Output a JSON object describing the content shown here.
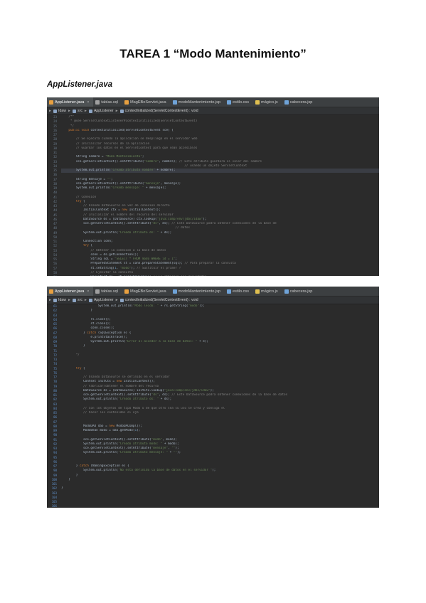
{
  "document": {
    "title": "TAREA 1 “Modo Mantenimiento”",
    "subtitle": "AppListener.java"
  },
  "shot1": {
    "tabs": [
      {
        "label": "AppListener.java",
        "active": true,
        "color": "#e8a040"
      },
      {
        "label": "tablas.sql",
        "active": false,
        "color": "#a0a0a0"
      },
      {
        "label": "MagEBoServlet.java",
        "active": false,
        "color": "#e8a040"
      },
      {
        "label": "modoMantenimiento.jsp",
        "active": false,
        "color": "#6fa3d8"
      },
      {
        "label": "estilo.css",
        "active": false,
        "color": "#6fa3d8"
      },
      {
        "label": "mágico.js",
        "active": false,
        "color": "#e0c050"
      },
      {
        "label": "cabecera.jsp",
        "active": false,
        "color": "#6fa3d8"
      }
    ],
    "crumbs": [
      "Idaw",
      "src",
      "AppListener",
      "contextInitialized(ServletContextEvent) : void"
    ],
    "line_numbers": [
      "23",
      "24",
      "25",
      "26",
      "27",
      "28",
      "29",
      "30",
      "31",
      "32",
      "33",
      "34",
      "35",
      "36",
      "37",
      "38",
      "39",
      "40",
      "41",
      "42",
      "43",
      "44",
      "45",
      "46",
      "47",
      "48",
      "49",
      "50",
      "51",
      "52",
      "53",
      "54",
      "55",
      "56",
      "57",
      "58",
      "59",
      "60",
      "61"
    ],
    "lines": [
      "    /**",
      "     * @see ServletContextListener#contextInitialized(ServletContextEvent)",
      "     */",
      "    public void contextInitialized(ServletContextEvent sce) {",
      "",
      "        // Se ejecuta cuando la aplicacion se despliega en el servidor web",
      "        // Inicializar recursos de la aplicacion",
      "        // Guardar los datos en el ServletContext para que sean accesibles",
      "",
      "        String nombre = \"Modo Mantenimiento\";",
      "        sce.getServletContext().setAttribute(\"nombre\", nombre); // Este atributo guardara el valor del nombre",
      "                                                                   // usando un objeto ServletContext",
      "        System.out.println(\"Creado atributo nombre\" + nombre);",
      "",
      "        String mensaje = \"\";",
      "        sce.getServletContext().setAttribute(\"mensaje\", mensaje);",
      "        System.out.println(\"Creado mensaje: \" + mensaje);",
      "",
      "        // Conexion",
      "        try {",
      "            // Usando DataSource en vez de conexion directa",
      "            InitialContext ctx = new InitialContext();",
      "            // Inicializar el nombre del recurso del servidor",
      "            DataSource ds = (DataSource) ctx.lookup(\"java:comp/env/jdbc/idaw\");",
      "            sce.getServletContext().setAttribute(\"ds\", ds); // Este DataSource podra obtener conexiones de la base de",
      "                                                              // datos",
      "            System.out.println(\"Creado atributo ds: \" + ds);",
      "",
      "            Connection conn;",
      "            try {",
      "                // Obtener la conexion a la base de datos",
      "                conn = ds.getConnection();",
      "                String sql = \"SELECT * FROM modo WHERE id = 1\";",
      "                PreparedStatement st = conn.prepareStatement(sql); // Para preparar la consulta",
      "                st.setString(1, \"modo\"); // Sustituir el primer ?",
      "                // Ejecutar la consulta",
      "                ResultSet rs = st.executeQuery(); // Se obtienen los resultados",
      "                while (rs.next()) {",
      "                    modo = rs.getString(\"modo\");"
    ],
    "highlight_index": 12
  },
  "shot2": {
    "tabs": [
      {
        "label": "AppListener.java",
        "active": true,
        "color": "#e8a040"
      },
      {
        "label": "tablas.sql",
        "active": false,
        "color": "#a0a0a0"
      },
      {
        "label": "MagEBoServlet.java",
        "active": false,
        "color": "#e8a040"
      },
      {
        "label": "modoMantenimiento.jsp",
        "active": false,
        "color": "#6fa3d8"
      },
      {
        "label": "estilo.css",
        "active": false,
        "color": "#6fa3d8"
      },
      {
        "label": "mágico.js",
        "active": false,
        "color": "#e0c050"
      },
      {
        "label": "cabecera.jsp",
        "active": false,
        "color": "#6fa3d8"
      }
    ],
    "crumbs": [
      "Idaw",
      "src",
      "AppListener",
      "contextInitialized(ServletContextEvent) : void"
    ],
    "line_numbers": [
      "61",
      "62",
      "63",
      "64",
      "65",
      "66",
      "67",
      "68",
      "69",
      "70",
      "71",
      "72",
      "73",
      "74",
      "75",
      "76",
      "77",
      "78",
      "79",
      "80",
      "81",
      "82",
      "83",
      "84",
      "85",
      "86",
      "87",
      "88",
      "89",
      "90",
      "91",
      "92",
      "93",
      "94",
      "95",
      "96",
      "97",
      "98",
      "99",
      "100",
      "101",
      "102",
      "103",
      "104",
      "105",
      "106",
      "107",
      "108"
    ],
    "lines": [
      "                    System.out.println(\"Modo leido: \" + rs.getString(\"modo\"));",
      "                }",
      "",
      "                rs.close();",
      "                st.close();",
      "                conn.close();",
      "            } catch (SQLException e) {",
      "                e.printStackTrace();",
      "                System.out.println(\"Error al acceder a la base de datos: \" + e);",
      "            }",
      "",
      "        */",
      "",
      "",
      "        try {",
      "",
      "            // Usando DataSource se definido en el servidor",
      "            Context initCtx = new InitialContext();",
      "            // Fabricar/obtener el nombre del recurso",
      "            DataSource ds = (DataSource) initCtx.lookup(\"java:comp/env/jdbc/idaw\");",
      "            sce.getServletContext().setAttribute(\"ds\", ds); // Este DataSource podra obtener conexiones de la base de datos",
      "            System.out.println(\"Creado atributo ds: \" + ds);",
      "",
      "            // Con los objetos de tipo Modo o de que otro sea su uso se crea y consiga el",
      "            // hacer los contenidos el ejb",
      "",
      "",
      "            ModoDAO dao = new ModoDAOImpl();",
      "            ModoBean modo = dao.getModo(1);",
      "",
      "            sce.getServletContext().setAttribute(\"modo\", modo);",
      "            System.out.println(\"Creado atributo modo: \" + modo);",
      "            sce.getServletContext().setAttribute(\"mensaje\", \"\");",
      "            System.out.println(\"Creado atributo mensaje: \" + \"\");",
      "",
      "",
      "        } catch (NamingException e) {",
      "            System.out.println(\"No esta definido la base de datos en el servidor \");",
      "        }",
      "    }",
      "",
      "}",
      "",
      "",
      "",
      "",
      "",
      ""
    ],
    "highlight_index": -1
  }
}
